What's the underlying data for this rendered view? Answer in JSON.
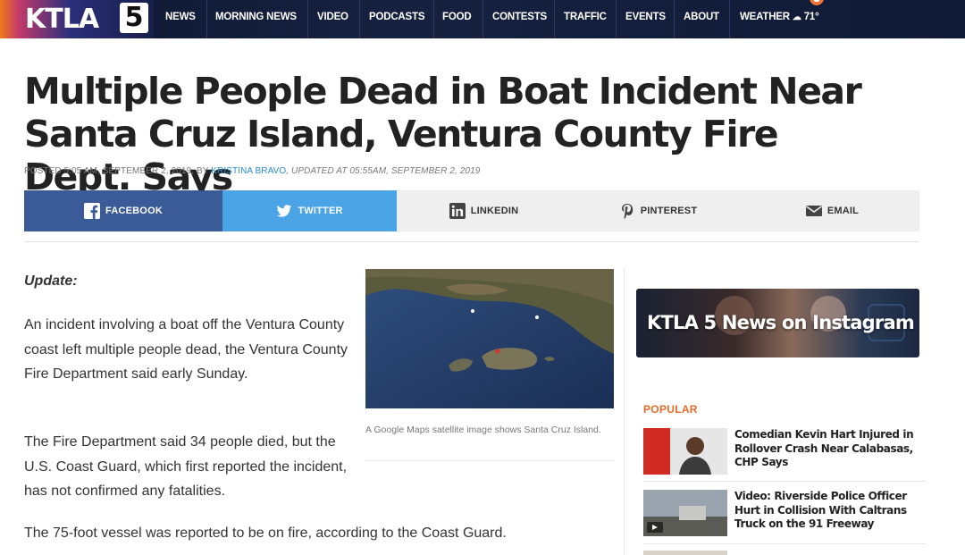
{
  "nav": {
    "logo_text": "KTLA",
    "logo_number": "5",
    "items": [
      "NEWS",
      "MORNING NEWS",
      "VIDEO",
      "PODCASTS",
      "FOOD",
      "CONTESTS",
      "TRAFFIC",
      "EVENTS",
      "ABOUT",
      "WEATHER"
    ],
    "weather_temp": "71°"
  },
  "article": {
    "headline": "Multiple People Dead in Boat Incident Near Santa Cruz Island, Ventura County Fire Dept. Says",
    "byline_posted": "POSTED 5:05 AM, SEPTEMBER 2, 2019, BY ",
    "byline_author": "KRISTINA BRAVO",
    "byline_updated": ", UPDATED AT 05:55AM, SEPTEMBER 2, 2019",
    "update_label": "Update:",
    "paragraphs": [
      "An incident involving a boat off the Ventura County coast left multiple people dead, the Ventura County Fire Department said early Sunday.",
      "The Fire Department said 34 people died, but the U.S. Coast Guard, which first reported the incident, has not confirmed any fatalities.",
      "The 75-foot vessel was reported to be on fire, according to the Coast Guard."
    ],
    "image_caption": "A Google Maps satellite image shows Santa Cruz Island."
  },
  "share": {
    "facebook": "FACEBOOK",
    "twitter": "TWITTER",
    "linkedin": "LINKEDIN",
    "pinterest": "PINTEREST",
    "email": "EMAIL"
  },
  "sidebar": {
    "instagram_banner": "KTLA 5 News on Instagram",
    "popular_label": "POPULAR",
    "popular_items": [
      "Comedian Kevin Hart Injured in Rollover Crash Near Calabasas, CHP Says",
      "Video: Riverside Police Officer Hurt in Collision With Caltrans Truck on the 91 Freeway"
    ]
  },
  "colors": {
    "nav_bg": "#0c1630",
    "facebook": "#3a5a98",
    "twitter": "#4aa4e5",
    "popular_accent": "#ec6a25",
    "author_link": "#2a8fcf"
  }
}
